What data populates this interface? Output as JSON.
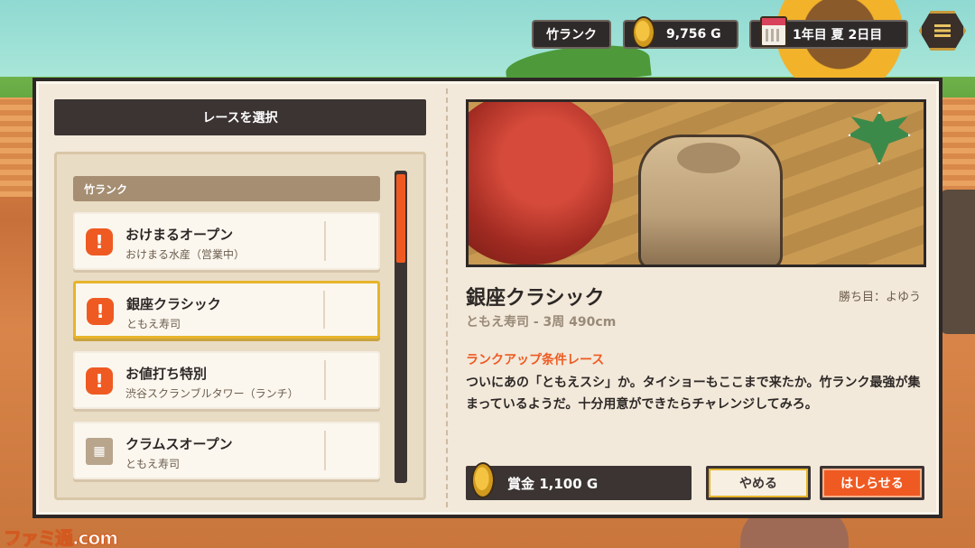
{
  "hud": {
    "rank": "竹ランク",
    "gold": "9,756 G",
    "date": "1年目 夏 2日目"
  },
  "list": {
    "title": "レースを選択",
    "group": "竹ランク",
    "races": [
      {
        "name": "おけまるオープン",
        "sub": "おけまる水産（営業中）",
        "icon": "!"
      },
      {
        "name": "銀座クラシック",
        "sub": "ともえ寿司",
        "icon": "!"
      },
      {
        "name": "お値打ち特別",
        "sub": "渋谷スクランブルタワー（ランチ）",
        "icon": "!"
      },
      {
        "name": "クラムスオープン",
        "sub": "ともえ寿司",
        "icon": "calendar-icon"
      }
    ],
    "selected_index": 1
  },
  "detail": {
    "title": "銀座クラシック",
    "win_condition": "勝ち目：よゆう",
    "subtitle": "ともえ寿司 - 3周 490cm",
    "tag": "ランクアップ条件レース",
    "description": "ついにあの「ともえスシ」か。タイショーもここまで来たか。竹ランク最強が集まっているようだ。十分用意ができたらチャレンジしてみろ。",
    "prize": "賞金 1,100 G",
    "cancel_label": "やめる",
    "go_label": "はしらせる"
  },
  "watermark": "ファミ通.com",
  "colors": {
    "accent": "#ef5a22",
    "panel": "#f2e9da",
    "dark": "#3b3433",
    "selected_border": "#e7b42a"
  }
}
